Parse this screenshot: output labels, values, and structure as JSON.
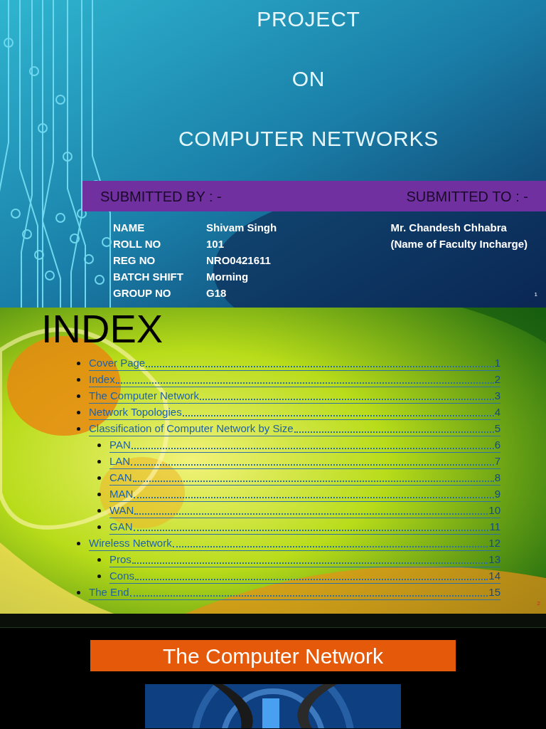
{
  "cover_slide": {
    "title_lines": [
      "PROJECT",
      "ON",
      "COMPUTER NETWORKS"
    ],
    "banner": {
      "left": "SUBMITTED BY : -",
      "right": "SUBMITTED TO : -"
    },
    "details": [
      {
        "label": "NAME",
        "value": "Shivam Singh"
      },
      {
        "label": "ROLL NO",
        "value": "101"
      },
      {
        "label": "REG NO",
        "value": "NRO0421611"
      },
      {
        "label": "BATCH SHIFT",
        "value": "Morning"
      },
      {
        "label": "GROUP NO",
        "value": "G18"
      }
    ],
    "faculty": [
      "Mr. Chandesh Chhabra",
      "(Name of Faculty Incharge)"
    ],
    "slide_number": "1"
  },
  "index_slide": {
    "title": "INDEX",
    "entries": [
      {
        "label": "Cover Page",
        "page": "1"
      },
      {
        "label": "Index",
        "page": "2"
      },
      {
        "label": "The Computer Network",
        "page": "3"
      },
      {
        "label": "Network Topologies",
        "page": "4"
      },
      {
        "label": "Classification of Computer Network by Size",
        "page": "5",
        "children": [
          {
            "label": "PAN",
            "page": "6"
          },
          {
            "label": "LAN",
            "page": "7"
          },
          {
            "label": "CAN",
            "page": "8"
          },
          {
            "label": "MAN",
            "page": "9"
          },
          {
            "label": "WAN",
            "page": "10"
          },
          {
            "label": "GAN",
            "page": "11"
          }
        ]
      },
      {
        "label": "Wireless Network",
        "page": "12",
        "children": [
          {
            "label": "Pros",
            "page": "13"
          },
          {
            "label": "Cons",
            "page": "14"
          }
        ]
      },
      {
        "label": "The End",
        "page": "15"
      }
    ],
    "slide_number": "2"
  },
  "network_slide": {
    "title": "The Computer Network"
  }
}
